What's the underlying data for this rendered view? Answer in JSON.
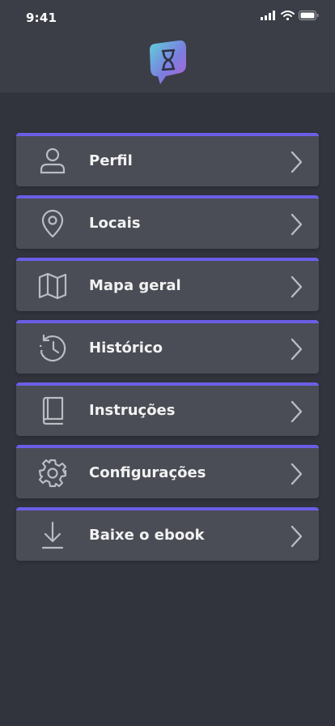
{
  "status_bar": {
    "time": "9:41"
  },
  "colors": {
    "accent": "#6b5ee6",
    "card": "#4a4d55",
    "background": "#31343c",
    "header": "#3b3e46",
    "icon": "#b9bcc3"
  },
  "menu": {
    "items": [
      {
        "label": "Perfil",
        "icon": "user-icon"
      },
      {
        "label": "Locais",
        "icon": "location-pin-icon"
      },
      {
        "label": "Mapa geral",
        "icon": "map-icon"
      },
      {
        "label": "Histórico",
        "icon": "history-icon"
      },
      {
        "label": "Instruções",
        "icon": "book-icon"
      },
      {
        "label": "Configurações",
        "icon": "gear-icon"
      },
      {
        "label": "Baixe o ebook",
        "icon": "download-icon"
      }
    ]
  }
}
